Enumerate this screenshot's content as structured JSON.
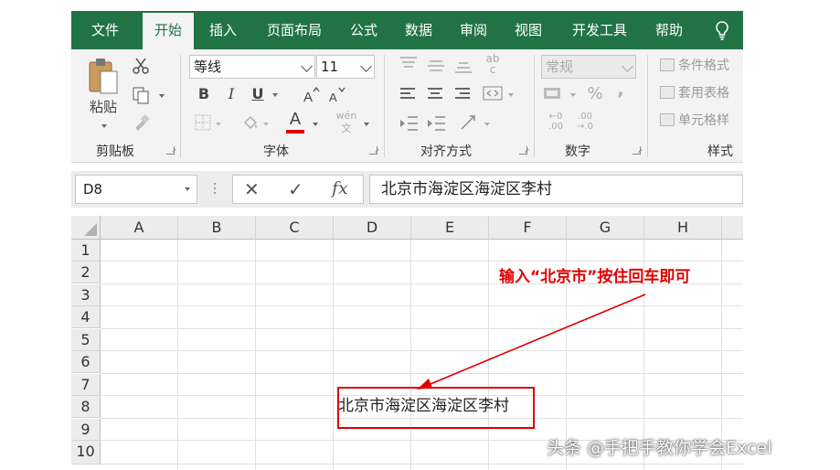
{
  "tabs": [
    {
      "label": "文件"
    },
    {
      "label": "开始"
    },
    {
      "label": "插入"
    },
    {
      "label": "页面布局"
    },
    {
      "label": "公式"
    },
    {
      "label": "数据"
    },
    {
      "label": "审阅"
    },
    {
      "label": "视图"
    },
    {
      "label": "开发工具"
    },
    {
      "label": "帮助"
    }
  ],
  "active_tab": "开始",
  "ribbon": {
    "clipboard": {
      "paste_label": "粘贴",
      "group_label": "剪贴板"
    },
    "font": {
      "font_name": "等线",
      "font_size": "11",
      "bold": "B",
      "italic": "I",
      "underline": "U",
      "font_color_glyph": "A",
      "wen_glyph": "wén",
      "group_label": "字体"
    },
    "alignment": {
      "group_label": "对齐方式"
    },
    "number": {
      "format": "常规",
      "percent": "%",
      "comma": ",",
      "group_label": "数字"
    },
    "styles": {
      "conditional": "条件格式",
      "table_format": "套用表格",
      "cell_styles": "单元格样",
      "group_label": "样式"
    }
  },
  "formula_bar": {
    "name_box": "D8",
    "cancel": "✕",
    "enter": "✓",
    "fx": "fx",
    "content": "北京市海淀区海淀区李村"
  },
  "grid": {
    "columns": [
      "A",
      "B",
      "C",
      "D",
      "E",
      "F",
      "G",
      "H"
    ],
    "rows": [
      "1",
      "2",
      "3",
      "4",
      "5",
      "6",
      "7",
      "8",
      "9",
      "10"
    ],
    "cells": {
      "D8": "北京市海淀区海淀区李村"
    }
  },
  "annotation": "输入“北京市”按住回车即可",
  "watermark": "头条 @手把手教你学会Excel",
  "colors": {
    "excel_green": "#217346",
    "annotation_red": "#e00000"
  }
}
